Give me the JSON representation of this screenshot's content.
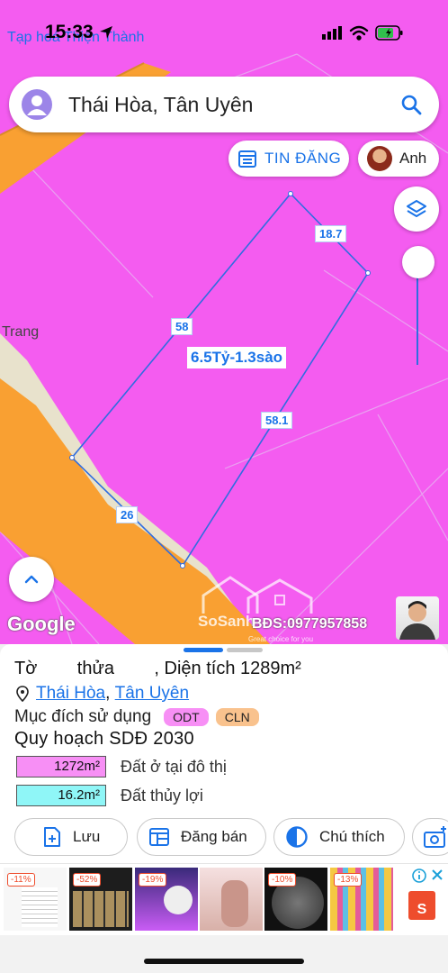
{
  "status": {
    "time": "15:33",
    "back_app": "Tạp hoá Thiện Thành"
  },
  "search": {
    "text": "Thái Hòa, Tân Uyên"
  },
  "chips": {
    "tin_dang": "TIN ĐĂNG",
    "user": "Anh"
  },
  "map": {
    "place_label": "Trang",
    "edges": {
      "top_right": "18.7",
      "left": "58",
      "right": "58.1",
      "bottom": "26"
    },
    "price_label": "6.5Tỷ-1.3sào",
    "google": "Google",
    "watermark": "SoSanh",
    "watermark_sub": "Great choice for you",
    "bds_phone": "BĐS:0977957858"
  },
  "panel": {
    "title": "Tờ        thửa        , Diện tích 1289m²",
    "location": {
      "commune": "Thái Hòa",
      "separator": ", ",
      "district": "Tân Uyên"
    },
    "purpose": {
      "label": "Mục đích sử dụng",
      "tags": [
        "ODT",
        "CLN"
      ]
    },
    "plan_title": "Quy hoạch SDĐ 2030",
    "areas": [
      {
        "value": "1272m²",
        "desc": "Đất ở tại đô thị",
        "color": "#f78ff5"
      },
      {
        "value": "16.2m²",
        "desc": "Đất thủy lợi",
        "color": "#8ff6f7"
      }
    ],
    "actions": {
      "save": "Lưu",
      "post": "Đăng bán",
      "legend": "Chú thích"
    }
  },
  "ads": {
    "badges": [
      "-11%",
      "-52%",
      "-19%",
      "-10%",
      "-13%"
    ]
  },
  "colors": {
    "accent": "#1a73e8",
    "map_pink": "#f45cf0",
    "road_orange": "#f9a032",
    "tag_odt": "#f78ff5",
    "tag_cln": "#f9c28d"
  }
}
